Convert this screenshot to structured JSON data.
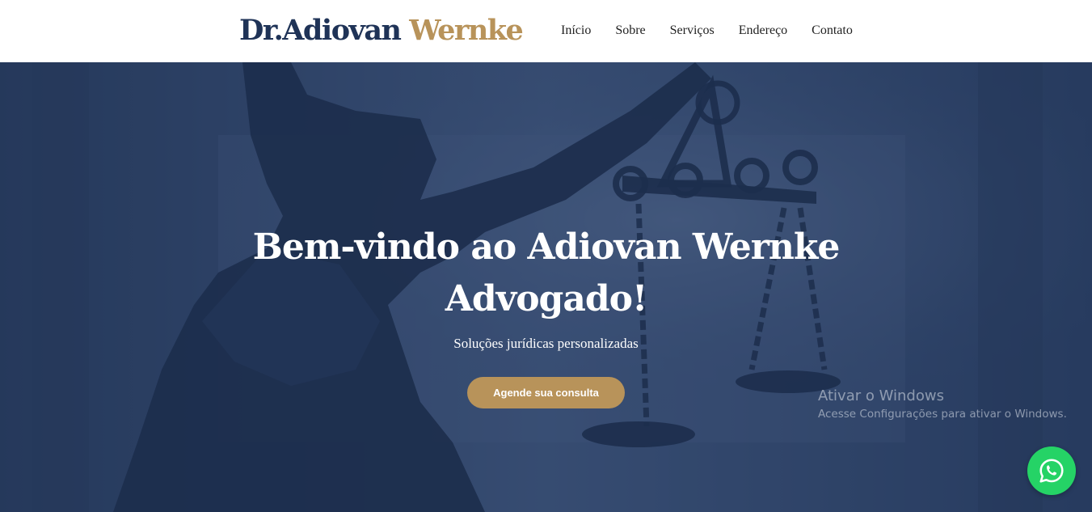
{
  "header": {
    "brand_primary": "Dr.Adiovan",
    "brand_accent": "Wernke",
    "nav": [
      {
        "label": "Início"
      },
      {
        "label": "Sobre"
      },
      {
        "label": "Serviços"
      },
      {
        "label": "Endereço"
      },
      {
        "label": "Contato"
      }
    ]
  },
  "hero": {
    "title_line1": "Bem-vindo ao Adiovan Wernke",
    "title_line2": "Advogado!",
    "subtitle": "Soluções jurídicas personalizadas",
    "cta_label": "Agende sua consulta"
  },
  "watermark": {
    "line1": "Ativar o Windows",
    "line2": "Acesse Configurações para ativar o Windows."
  },
  "floating": {
    "whatsapp_icon": "whatsapp-icon"
  },
  "colors": {
    "navy": "#1f3357",
    "gold": "#b8935a",
    "whatsapp": "#25d366"
  }
}
